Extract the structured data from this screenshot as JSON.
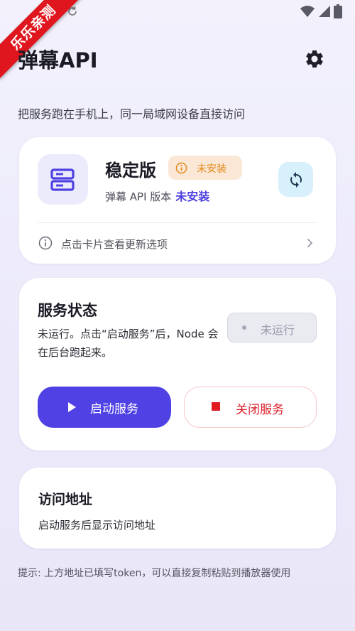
{
  "ribbon": {
    "text": "乐乐亲测"
  },
  "header": {
    "title": "弹幕API",
    "subtitle": "把服务跑在手机上，同一局域网设备直接访问"
  },
  "version_card": {
    "edition": "稳定版",
    "status_badge": "未安装",
    "version_label": "弹幕 API 版本",
    "version_value": "未安装",
    "hint": "点击卡片查看更新选项"
  },
  "service_card": {
    "title": "服务状态",
    "description": "未运行。点击“启动服务”后，Node 会在后台跑起来。",
    "run_status": "未运行",
    "start_label": "启动服务",
    "stop_label": "关闭服务"
  },
  "address_card": {
    "title": "访问地址",
    "description": "启动服务后显示访问地址"
  },
  "footer": {
    "tip": "提示: 上方地址已填写token，可以直接复制粘贴到播放器使用"
  },
  "colors": {
    "accent": "#4f41e3",
    "warning": "#e08a1c",
    "danger": "#e01b22",
    "refresh_bg": "#d7f0fb",
    "ribbon": "#e0161e"
  },
  "icons": [
    "sync-icon",
    "wifi-icon",
    "signal-icon",
    "battery-icon",
    "gear-icon",
    "server-icon",
    "info-circle-icon",
    "refresh-icon",
    "chevron-right-icon",
    "play-icon",
    "stop-icon"
  ]
}
